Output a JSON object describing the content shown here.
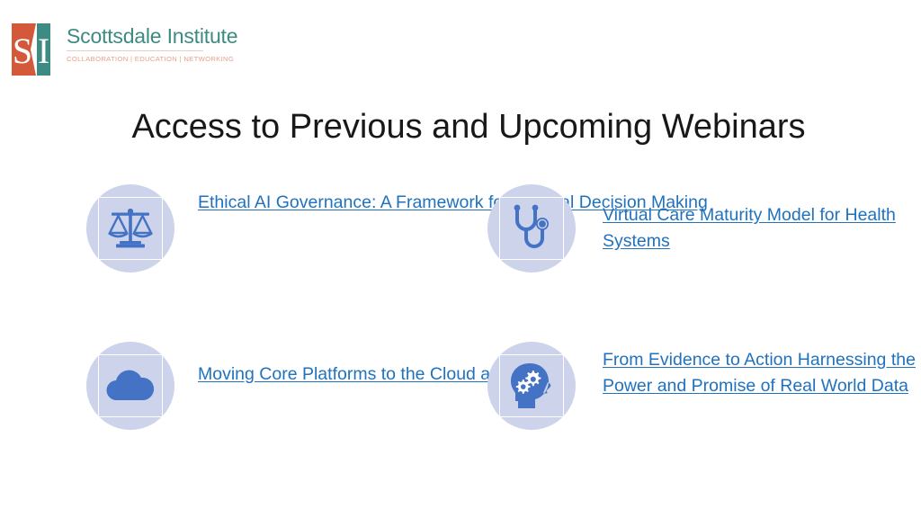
{
  "logo": {
    "mark_letters": [
      "S",
      "I"
    ],
    "name": "Scottsdale Institute",
    "tagline": "COLLABORATION  |  EDUCATION  |  NETWORKING",
    "colors": {
      "orange": "#d4593a",
      "teal": "#3d8b82",
      "tagline": "#e9a088"
    }
  },
  "title": "Access to Previous and Upcoming Webinars",
  "theme": {
    "background": "#ffffff",
    "title_color": "#181818",
    "icon_circle_bg": "#ccd3ea",
    "icon_color": "#4472c4",
    "link_color": "#2072be"
  },
  "webinars": [
    {
      "icon": "scales-of-justice-icon",
      "title": "Ethical AI Governance: A Framework for Medical Decision Making"
    },
    {
      "icon": "stethoscope-icon",
      "title": "Virtual Care Maturity Model for Health Systems"
    },
    {
      "icon": "cloud-icon",
      "title": "Moving Core Platforms to the Cloud at Sentara"
    },
    {
      "icon": "head-with-gears-icon",
      "title": "From Evidence to Action Harnessing the Power and Promise of Real World Data"
    }
  ]
}
